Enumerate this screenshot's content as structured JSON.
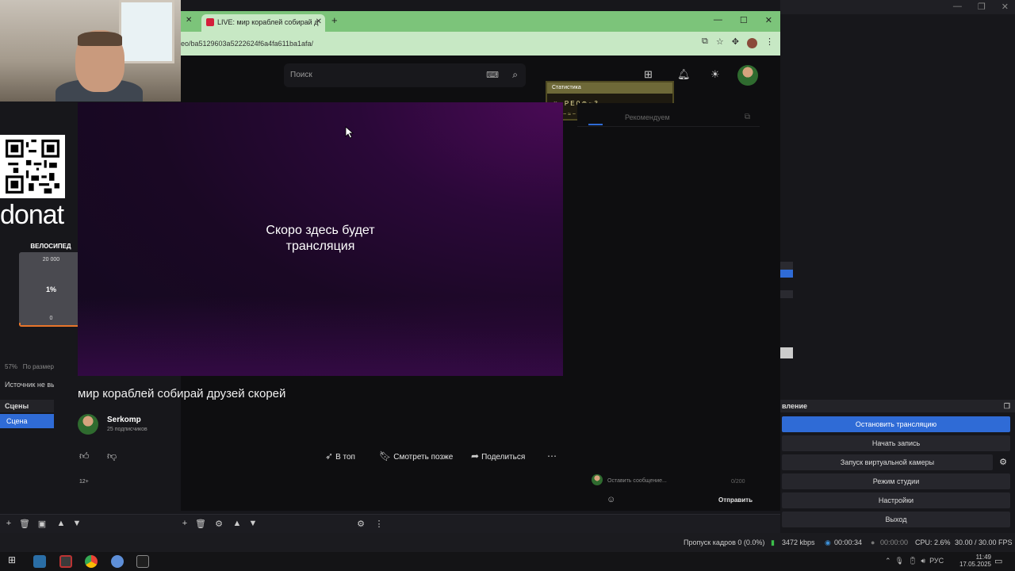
{
  "browser": {
    "tab_title": "LIVE: мир кораблей собирай д",
    "url": "eo/ba5129603a5222624f6a4fa611ba1afa/"
  },
  "site": {
    "search_placeholder": "Поиск",
    "notification_badge": "99+",
    "stats_popup": {
      "title": "Статистика",
      "line1": "♥ ~ P E 0 ⊕ ~ 3",
      "line2": "‣ ~ ~ ≈ ~ ~"
    },
    "video_message": "Скоро здесь будет трансляция",
    "video_title": "мир кораблей собирай друзей скорей",
    "channel_name": "Serkomp",
    "channel_subs": "25 подписчиков",
    "actions": {
      "top": "В топ",
      "watch_later": "Смотреть позже",
      "share": "Поделиться"
    },
    "age_rating": "12+",
    "chat": {
      "tab_recommended": "Рекомендуем",
      "input_placeholder": "Оставить сообщение...",
      "char_count": "0/200",
      "send_label": "Отправить"
    }
  },
  "overlay": {
    "donat_label": "donat",
    "goal_title": "ВЕЛОСИПЕД",
    "goal_max": "20 000",
    "goal_percent_text": "1%",
    "goal_min": "0",
    "goal_progress_percent": 1
  },
  "obs": {
    "zoom": "57%",
    "zoom_mode": "По размер",
    "source_none": "Источник не вы",
    "scenes_header": "Сцены",
    "scene_item": "Сцена",
    "controls_header": "вление",
    "controls": {
      "stop_stream": "Остановить трансляцию",
      "start_recording": "Начать запись",
      "virtual_camera": "Запуск виртуальной камеры",
      "studio_mode": "Режим студии",
      "settings": "Настройки",
      "exit": "Выход"
    },
    "status": {
      "dropped_frames": "Пропуск кадров 0 (0.0%)",
      "bitrate": "3472 kbps",
      "stream_time": "00:00:34",
      "rec_time": "00:00:00",
      "cpu": "CPU: 2.6%",
      "fps": "30.00 / 30.00 FPS"
    },
    "fps_badge": "FPS"
  },
  "taskbar": {
    "lang": "РУС",
    "time": "11:49",
    "date": "17.05.2025"
  },
  "colors": {
    "accent_blue": "#2f6bd6",
    "tab_green": "#7cc47a",
    "goal_orange": "#e8752a"
  }
}
